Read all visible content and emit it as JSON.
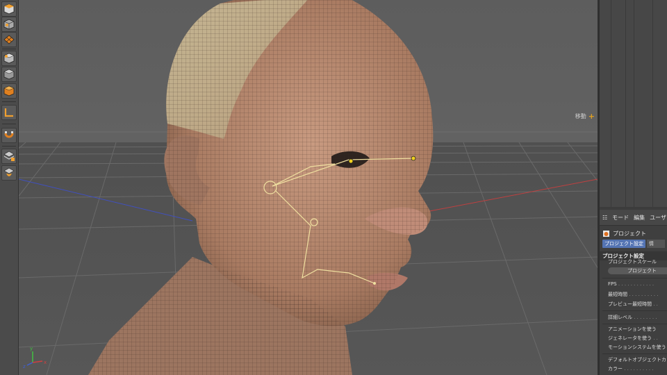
{
  "toolbar": {
    "tools": [
      {
        "name": "view-cube-icon"
      },
      {
        "name": "grid-cube-icon"
      },
      {
        "name": "checker-icon"
      },
      {
        "name": "cube-outline-icon"
      },
      {
        "name": "cube-solid-icon"
      },
      {
        "name": "cube-orange-icon"
      },
      {
        "name": "axis-icon"
      },
      {
        "name": "magnet-icon"
      },
      {
        "name": "layer-lock-icon"
      },
      {
        "name": "layer-sound-icon"
      }
    ]
  },
  "viewport": {
    "move_label": "移動",
    "axis_x": "x",
    "axis_y": "y",
    "axis_z": "z",
    "colors": {
      "background": "#5a5a5a",
      "floor": "#535353",
      "grid": "#6b6b6b",
      "skin": "#b98a70",
      "axis_red": "#c04040",
      "axis_blue": "#4050c0",
      "spline": "#f0e0a0"
    }
  },
  "attributes": {
    "menu": [
      "モード",
      "編集",
      "ユーザ"
    ],
    "title": "プロジェクト",
    "tab_active": "プロジェクト設定",
    "tab_other": "情",
    "section": "プロジェクト設定",
    "rows": {
      "project_scale": "プロジェクトスケール",
      "project_scale_button": "プロジェクト",
      "fps": "FPS",
      "min_time": "最短時間",
      "preview_min_time": "プレビュー最短時間",
      "detail_level": "詳細レベル",
      "use_animation": "アニメーションを使う",
      "use_generator": "ジェネレータを使う",
      "use_motion_system": "モーションシステムを使う",
      "default_object_color": "デフォルトオブジェクトカラー",
      "color": "カラー"
    }
  }
}
